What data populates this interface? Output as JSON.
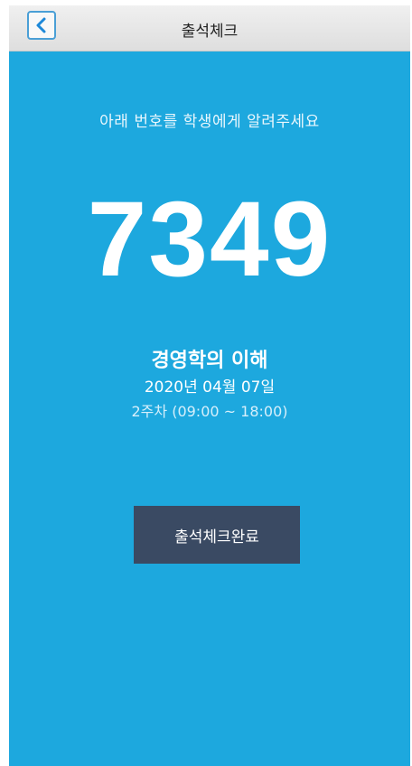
{
  "header": {
    "title": "출석체크",
    "back_icon": "chevron-left-icon"
  },
  "main": {
    "instruction": "아래 번호를 학생에게 알려주세요",
    "code": "7349",
    "course_name": "경영학의 이해",
    "date": "2020년 04월 07일",
    "session": "2주차 (09:00 ~ 18:00)",
    "complete_button_label": "출석체크완료"
  },
  "colors": {
    "background": "#1da8de",
    "button": "#3a4a63",
    "back_icon": "#1e88d8"
  }
}
